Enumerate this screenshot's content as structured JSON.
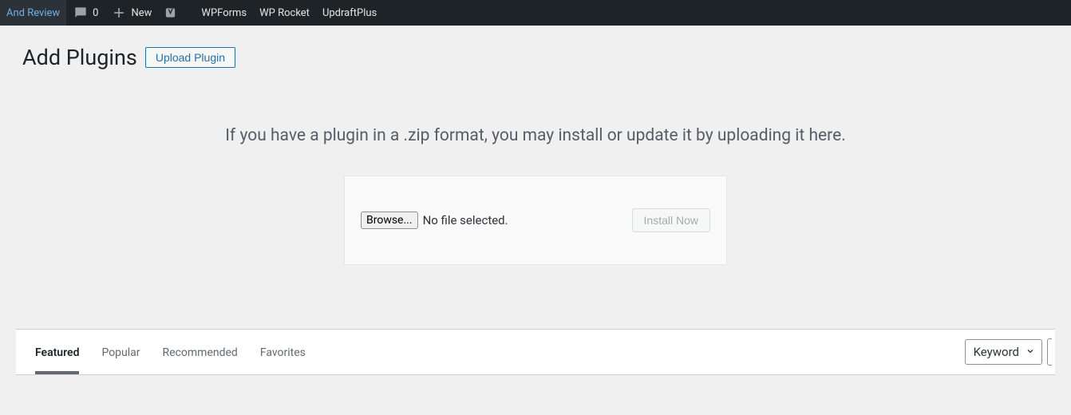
{
  "adminbar": {
    "review": "And Review",
    "comments_count": "0",
    "new": "New",
    "items": [
      "WPForms",
      "WP Rocket",
      "UpdraftPlus"
    ]
  },
  "header": {
    "title": "Add Plugins",
    "upload_button": "Upload Plugin"
  },
  "upload": {
    "help": "If you have a plugin in a .zip format, you may install or update it by uploading it here.",
    "browse": "Browse...",
    "file_status": "No file selected.",
    "install": "Install Now"
  },
  "tabs": {
    "featured": "Featured",
    "popular": "Popular",
    "recommended": "Recommended",
    "favorites": "Favorites"
  },
  "search": {
    "type_label": "Keyword"
  }
}
